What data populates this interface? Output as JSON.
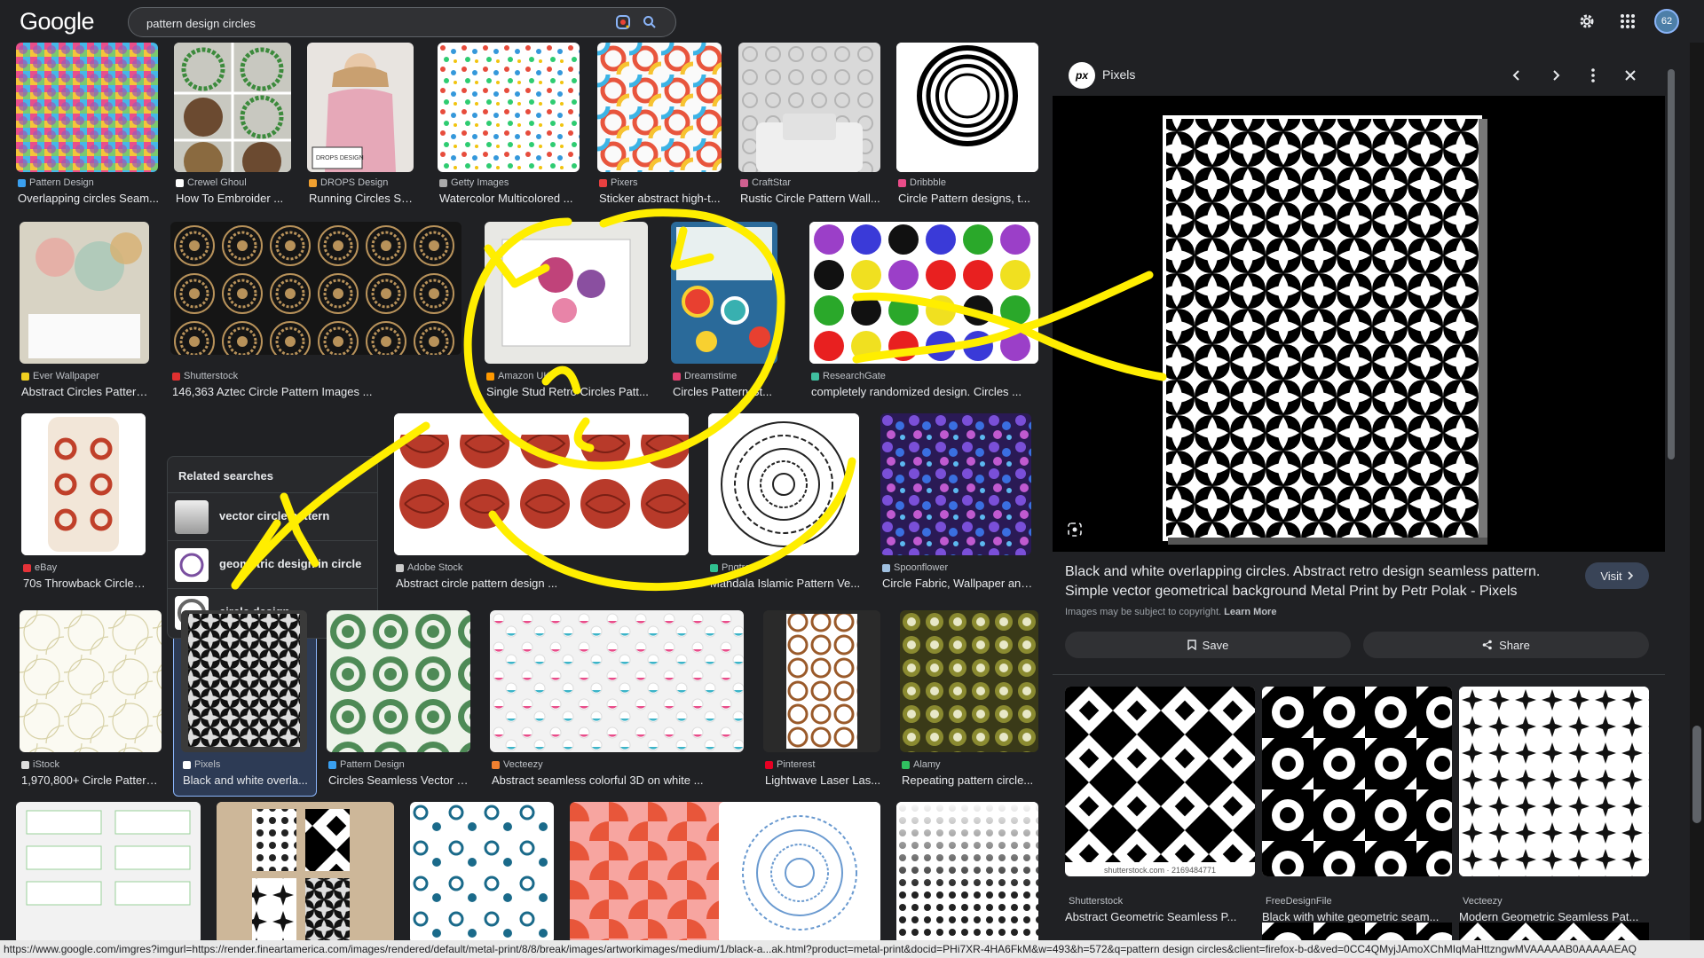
{
  "header": {
    "logo": "Google",
    "search_value": "pattern design circles",
    "icons": [
      "google-lens-icon",
      "search-icon",
      "settings-gear-icon",
      "apps-grid-icon"
    ],
    "avatar_initials": "62"
  },
  "results": [
    {
      "source": "Pattern Design",
      "caption": "Overlapping circles Seam...",
      "fav_color": "#3aa0f0"
    },
    {
      "source": "Crewel Ghoul",
      "caption": "How To Embroider ...",
      "fav_color": "#ffffff"
    },
    {
      "source": "DROPS Design",
      "caption": "Running Circles Sw...",
      "fav_color": "#f0a030"
    },
    {
      "source": "Getty Images",
      "caption": "Watercolor Multicolored ...",
      "fav_color": "#aaaaaa"
    },
    {
      "source": "Pixers",
      "caption": "Sticker abstract high-t...",
      "fav_color": "#e84040"
    },
    {
      "source": "CraftStar",
      "caption": "Rustic Circle Pattern Wall...",
      "fav_color": "#d06090"
    },
    {
      "source": "Dribbble",
      "caption": "Circle Pattern designs, t...",
      "fav_color": "#ea4c89"
    },
    {
      "source": "Ever Wallpaper",
      "caption": "Abstract Circles Pattern...",
      "fav_color": "#f0d020"
    },
    {
      "source": "Shutterstock",
      "caption": "146,363 Aztec Circle Pattern Images ...",
      "fav_color": "#e03030"
    },
    {
      "source": "Amazon UK",
      "caption": "Single Stud Retro Circles Patt...",
      "fav_color": "#ff9900"
    },
    {
      "source": "Dreamstime",
      "caption": "Circles Pattern St...",
      "fav_color": "#e04070"
    },
    {
      "source": "ResearchGate",
      "caption": "completely randomized design. Circles ...",
      "fav_color": "#40c0a0"
    },
    {
      "source": "eBay",
      "caption": "70s Throwback Circles ...",
      "fav_color": "#e53238"
    },
    {
      "source": "Adobe Stock",
      "caption": "Abstract circle pattern design ...",
      "fav_color": "#cccccc"
    },
    {
      "source": "Pngtree",
      "caption": "Mandala Islamic Pattern Ve...",
      "fav_color": "#30c090"
    },
    {
      "source": "Spoonflower",
      "caption": "Circle Fabric, Wallpaper and ...",
      "fav_color": "#a0c0e0"
    },
    {
      "source": "iStock",
      "caption": "1,970,800+ Circle Pattern ...",
      "fav_color": "#dddddd"
    },
    {
      "source": "Pixels",
      "caption": "Black and white overla...",
      "fav_color": "#ffffff"
    },
    {
      "source": "Pattern Design",
      "caption": "Circles Seamless Vector P...",
      "fav_color": "#3aa0f0"
    },
    {
      "source": "Vecteezy",
      "caption": "Abstract seamless colorful 3D on white ...",
      "fav_color": "#f08030"
    },
    {
      "source": "Pinterest",
      "caption": "Lightwave Laser Las...",
      "fav_color": "#e60023"
    },
    {
      "source": "Alamy",
      "caption": "Repeating pattern circle...",
      "fav_color": "#30c060"
    }
  ],
  "related_searches": {
    "title": "Related searches",
    "items": [
      "vector circle pattern",
      "geometric design in circle",
      "circle design"
    ]
  },
  "panel": {
    "site": "Pixels",
    "site_favicon_text": "px",
    "title": "Black and white overlapping circles. Abstract retro design seamless pattern. Simple vector geometrical background Metal Print by Petr Polak - Pixels",
    "visit_label": "Visit",
    "copyright": "Images may be subject to copyright.",
    "learn_more": "Learn More",
    "save_label": "Save",
    "share_label": "Share",
    "related": [
      {
        "source": "Shutterstock",
        "caption": "Abstract Geometric Seamless P...",
        "fav_color": "#e03030",
        "watermark": "shutterstock.com · 2169484771"
      },
      {
        "source": "FreeDesignFile",
        "caption": "Black with white geometric seam...",
        "fav_color": "#f0b030"
      },
      {
        "source": "Vecteezy",
        "caption": "Modern Geometric Seamless Pat...",
        "fav_color": "#f08030"
      }
    ]
  },
  "status_url": "https://www.google.com/imgres?imgurl=https://render.fineartamerica.com/images/rendered/default/metal-print/8/8/break/images/artworkimages/medium/1/black-a...ak.html?product=metal-print&docid=PHi7XR-4HA6FkM&w=493&h=572&q=pattern design circles&client=firefox-b-d&ved=0CC4QMyjJAmoXChMIqMaHttzngwMVAAAAAB0AAAAAEAQ",
  "annotation": {
    "color": "#ffee00",
    "description": "yellow hand-drawn smiley face and two arrows"
  }
}
